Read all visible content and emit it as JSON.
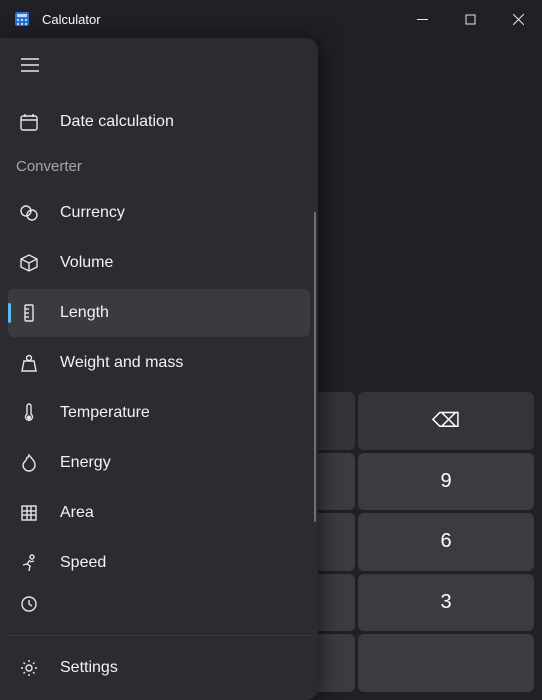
{
  "app": {
    "title": "Calculator"
  },
  "nav": {
    "sections": {
      "converter_label": "Converter"
    },
    "items": {
      "date_calculation": "Date calculation",
      "currency": "Currency",
      "volume": "Volume",
      "length": "Length",
      "weight": "Weight and mass",
      "temperature": "Temperature",
      "energy": "Energy",
      "area": "Area",
      "speed": "Speed"
    },
    "footer": {
      "settings": "Settings"
    }
  },
  "keypad": {
    "backspace_glyph": "⌫",
    "r0c2": "9",
    "r1c2": "6",
    "r2c2": "3"
  }
}
